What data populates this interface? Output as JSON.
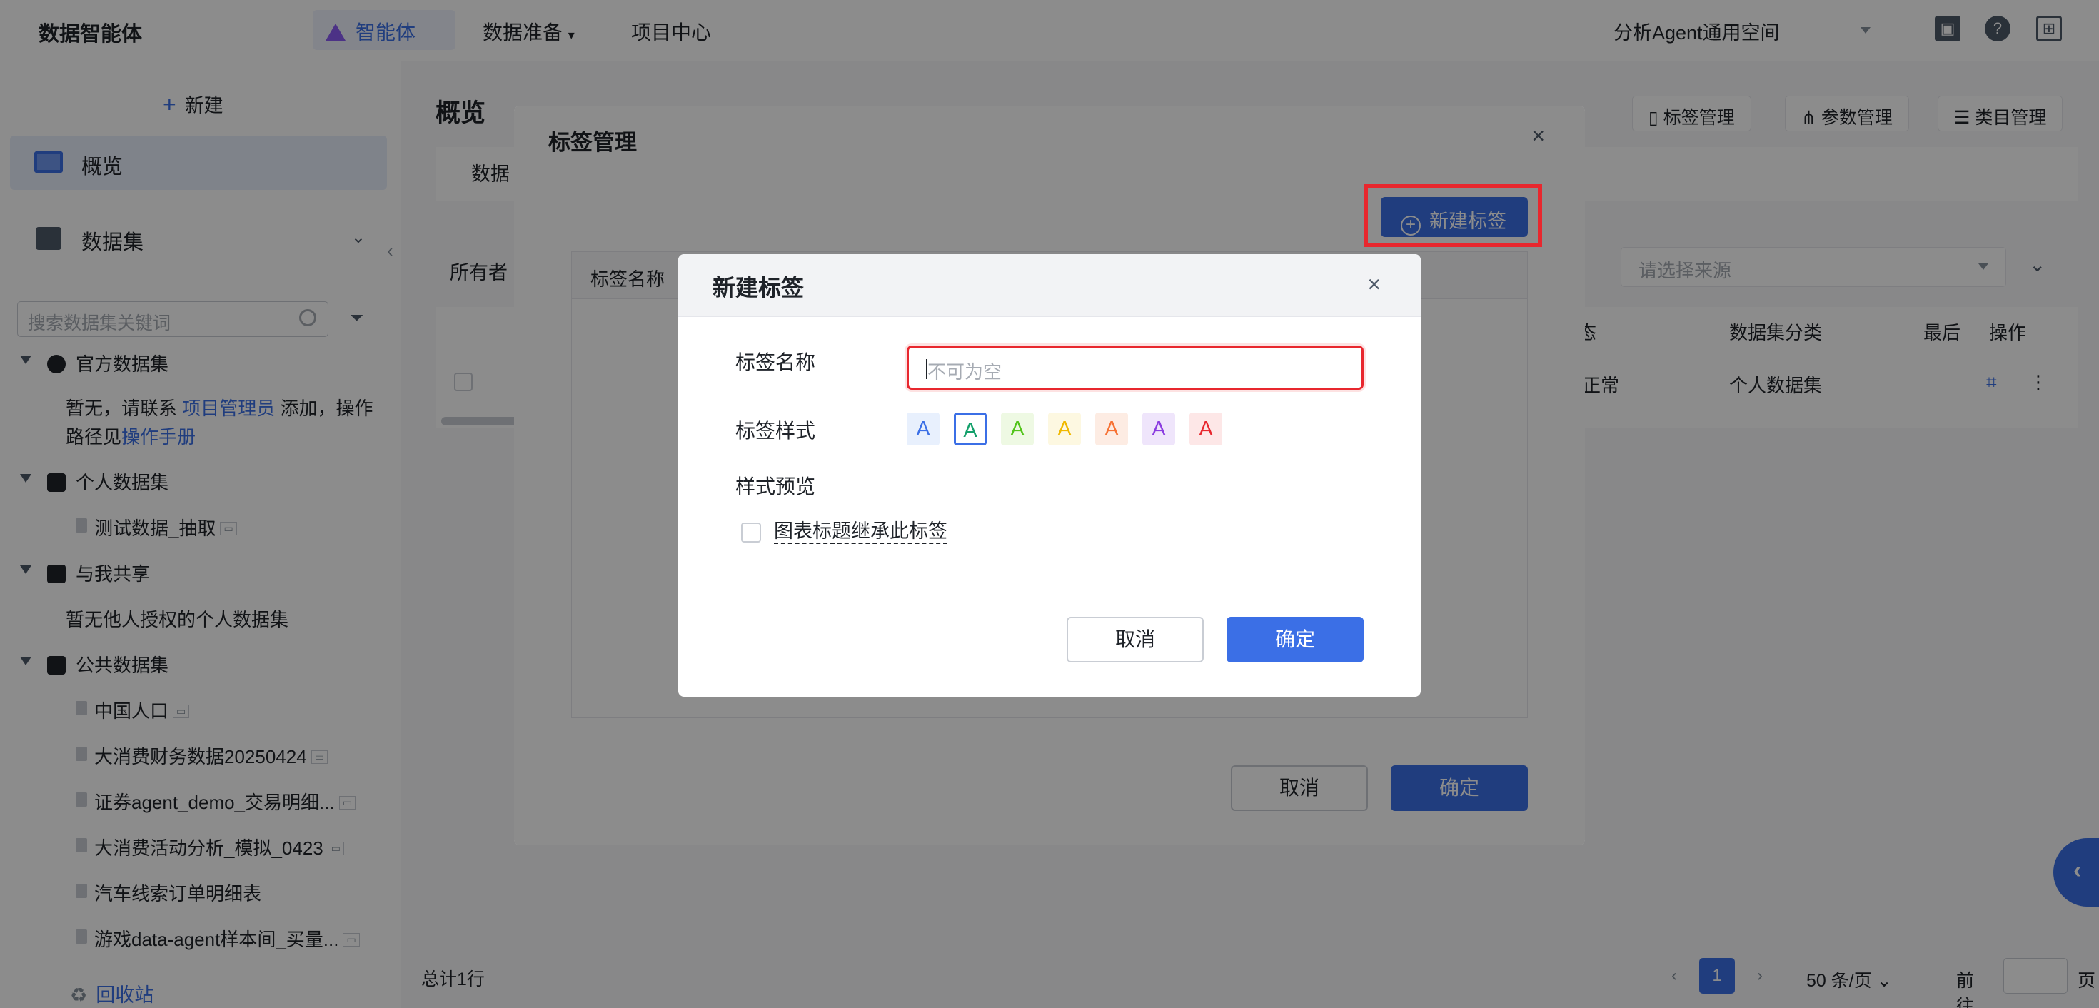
{
  "topbar": {
    "brand": "数据智能体",
    "tabs": [
      {
        "label": "智能体"
      },
      {
        "label": "数据准备"
      },
      {
        "label": "项目中心"
      }
    ],
    "workspace": "分析Agent通用空间"
  },
  "sidebar": {
    "new_label": "新建",
    "nav": [
      {
        "label": "概览"
      },
      {
        "label": "数据集"
      }
    ],
    "search_placeholder": "搜索数据集关键词",
    "groups": {
      "official": {
        "label": "官方数据集",
        "note_1": "暂无，请联系",
        "note_link": "项目管理员",
        "note_2": "添加，操作",
        "note_3": "路径见",
        "manual_link": "操作手册"
      },
      "personal": {
        "label": "个人数据集",
        "items": [
          "测试数据_抽取"
        ]
      },
      "shared": {
        "label": "与我共享",
        "empty": "暂无他人授权的个人数据集"
      },
      "public": {
        "label": "公共数据集",
        "items": [
          "中国人口",
          "大消费财务数据20250424",
          "证券agent_demo_交易明细...",
          "大消费活动分析_模拟_0423",
          "汽车线索订单明细表",
          "游戏data-agent样本间_买量..."
        ]
      }
    },
    "recycle": "回收站"
  },
  "main": {
    "title": "概览",
    "tab": "数据",
    "header_buttons": [
      "标签管理",
      "参数管理",
      "类目管理"
    ],
    "owner_label": "所有者",
    "source_placeholder": "请选择来源",
    "table_headers": [
      "态",
      "数据集分类",
      "最后",
      "操作"
    ],
    "row": {
      "status": "正常",
      "category": "个人数据集"
    },
    "total": "总计1行",
    "pager": {
      "current": "1",
      "page_size": "50 条/页",
      "goto": "前往",
      "page_suffix": "页"
    }
  },
  "tag_manager": {
    "title": "标签管理",
    "new_button": "新建标签",
    "column_name": "标签名称",
    "cancel": "取消",
    "ok": "确定"
  },
  "new_tag": {
    "title": "新建标签",
    "name_label": "标签名称",
    "name_placeholder": "不可为空",
    "style_label": "标签样式",
    "preview_label": "样式预览",
    "styles": [
      {
        "text": "A",
        "color": "#3b6fe6",
        "bg": "#e8f0fd"
      },
      {
        "text": "A",
        "color": "#14a06b",
        "bg": "#ffffff",
        "selected": true
      },
      {
        "text": "A",
        "color": "#52c41a",
        "bg": "#eef9e3"
      },
      {
        "text": "A",
        "color": "#f0b800",
        "bg": "#fdf8e1"
      },
      {
        "text": "A",
        "color": "#f77234",
        "bg": "#fdece3"
      },
      {
        "text": "A",
        "color": "#8a3ce0",
        "bg": "#efe5fb"
      },
      {
        "text": "A",
        "color": "#e8272e",
        "bg": "#fde7e7"
      }
    ],
    "inherit_label": "图表标题继承此标签",
    "cancel": "取消",
    "ok": "确定"
  }
}
